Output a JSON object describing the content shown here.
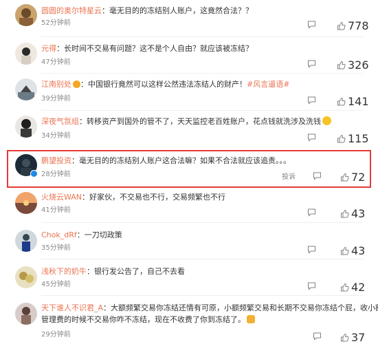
{
  "comments": [
    {
      "user": "圆圆的奥尔特星云",
      "text": "毫无目的的冻结别人账户，这竟然合法？？",
      "time": "52分钟前",
      "likes": "778"
    },
    {
      "user": "元得",
      "text": "长时间不交易有问题？这不是个人自由？就应该被冻结？",
      "time": "",
      "likes": ""
    },
    {
      "user": "",
      "text": "",
      "time": "47分钟前",
      "likes": "326"
    },
    {
      "user": "江南别处",
      "text": "中国银行竟然可以这样公然违法冻结人的财产！",
      "tag": "#风言逼语#",
      "time": "39分钟前",
      "likes": "141"
    },
    {
      "user": "深夜气氛组",
      "text": "转移资产到国外的管不了，天天监控老百姓账户，花点钱就洗涉及洗钱",
      "time": "34分钟前",
      "likes": "115"
    },
    {
      "user": "鹏望投资",
      "text": "毫无目的的冻结别人账户这合法嘛？如果不合法就应该追责。。。",
      "time": "28分钟前",
      "likes": "72",
      "report": "投诉"
    },
    {
      "user": "火烧云WAN",
      "text": "好家伙，不交易也不行，交易频繁也不行",
      "time": "41分钟前",
      "likes": "43"
    },
    {
      "user": "Chok_dRf",
      "text": "一刀切政策",
      "time": "35分钟前",
      "likes": "43"
    },
    {
      "user": "浅秋下的奶牛",
      "text": "银行发公告了，自己不去看",
      "time": "45分钟前",
      "likes": "42"
    },
    {
      "user": "天下谁人不识君_A",
      "text": "大额频繁交易你冻结还情有可原，小额频繁交易和长期不交易你冻结个屁，收小额",
      "text2": "管理费的时候不交易你咋不冻结，现在不收费了你到冻结了。",
      "time": "29分钟前",
      "likes": "37"
    }
  ],
  "colors": {
    "username": "#eb7350",
    "highlight": "#e53935",
    "meta": "#808080"
  }
}
